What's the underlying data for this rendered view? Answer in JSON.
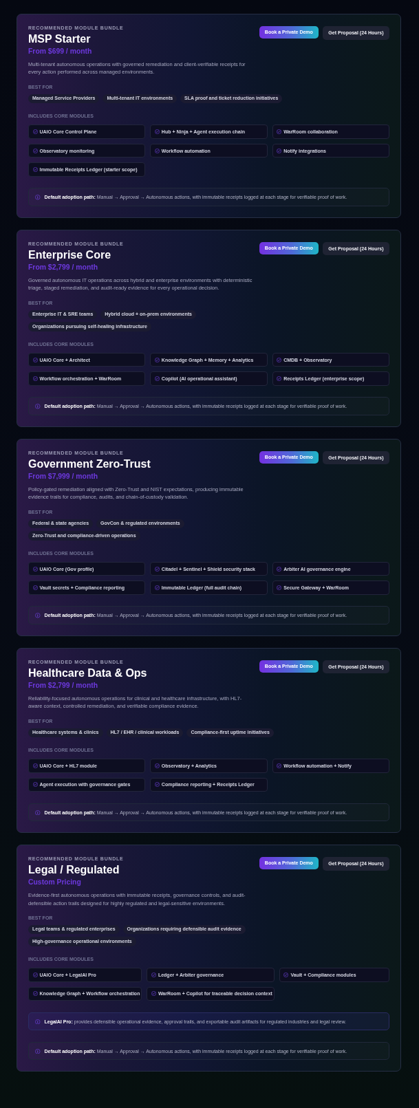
{
  "bundles": [
    {
      "eyebrow": "RECOMMENDED MODULE BUNDLE",
      "title": "MSP Starter",
      "price": "From $699 / month",
      "description": "Multi-tenant autonomous operations with governed remediation and client-verifiable receipts for every action performed across managed environments.",
      "best_for_label": "BEST FOR",
      "best_for": [
        "Managed Service Providers",
        "Multi-tenant IT environments",
        "SLA proof and ticket reduction initiatives"
      ],
      "modules_label": "INCLUDES CORE MODULES",
      "modules": [
        "UAIO Core Control Plane",
        "Hub + Ninja + Agent execution chain",
        "WarRoom collaboration",
        "Observatory monitoring",
        "Workflow automation",
        "Notify integrations",
        "Immutable Receipts Ledger (starter scope)"
      ],
      "notes": [
        {
          "kind": "adoption",
          "text": "**Default adoption path:** Manual → Approval → Autonomous actions, with immutable receipts logged at each stage for verifiable proof of work."
        }
      ],
      "buttons": [
        {
          "kind": "primary",
          "label": "Book a Private Demo"
        },
        {
          "kind": "secondary",
          "label": "Get Proposal (24 Hours)"
        }
      ]
    },
    {
      "eyebrow": "RECOMMENDED MODULE BUNDLE",
      "title": "Enterprise Core",
      "price": "From $2,799 / month",
      "description": "Governed autonomous IT operations across hybrid and enterprise environments with deterministic triage, staged remediation, and audit-ready evidence for every operational decision.",
      "best_for_label": "BEST FOR",
      "best_for": [
        "Enterprise IT & SRE teams",
        "Hybrid cloud + on-prem environments",
        "Organizations pursuing self-healing infrastructure"
      ],
      "modules_label": "INCLUDES CORE MODULES",
      "modules": [
        "UAIO Core + Architect",
        "Knowledge Graph + Memory + Analytics",
        "CMDB + Observatory",
        "Workflow orchestration + WarRoom",
        "Copilot (AI operational assistant)",
        "Receipts Ledger (enterprise scope)"
      ],
      "notes": [
        {
          "kind": "adoption",
          "text": "**Default adoption path:** Manual → Approval → Autonomous actions, with immutable receipts logged at each stage for verifiable proof of work."
        }
      ],
      "buttons": [
        {
          "kind": "primary",
          "label": "Book a Private Demo"
        },
        {
          "kind": "secondary",
          "label": "Get Proposal (24 Hours)"
        }
      ]
    },
    {
      "eyebrow": "RECOMMENDED MODULE BUNDLE",
      "title": "Government Zero-Trust",
      "price": "From $7,999 / month",
      "description": "Policy-gated remediation aligned with Zero-Trust and NIST expectations, producing immutable evidence trails for compliance, audits, and chain-of-custody validation.",
      "best_for_label": "BEST FOR",
      "best_for": [
        "Federal & state agencies",
        "GovCon & regulated environments",
        "Zero-Trust and compliance-driven operations"
      ],
      "modules_label": "INCLUDES CORE MODULES",
      "modules": [
        "UAIO Core (Gov profile)",
        "Citadel + Sentinel + Shield security stack",
        "Arbiter AI governance engine",
        "Vault secrets + Compliance reporting",
        "Immutable Ledger (full audit chain)",
        "Secure Gateway + WarRoom"
      ],
      "notes": [
        {
          "kind": "adoption",
          "text": "**Default adoption path:** Manual → Approval → Autonomous actions, with immutable receipts logged at each stage for verifiable proof of work."
        }
      ],
      "buttons": [
        {
          "kind": "primary",
          "label": "Book a Private Demo"
        },
        {
          "kind": "secondary",
          "label": "Get Proposal (24 Hours)"
        }
      ]
    },
    {
      "eyebrow": "RECOMMENDED MODULE BUNDLE",
      "title": "Healthcare Data & Ops",
      "price": "From $2,799 / month",
      "description": "Reliability-focused autonomous operations for clinical and healthcare infrastructure, with HL7-aware context, controlled remediation, and verifiable compliance evidence.",
      "best_for_label": "BEST FOR",
      "best_for": [
        "Healthcare systems & clinics",
        "HL7 / EHR / clinical workloads",
        "Compliance-first uptime initiatives"
      ],
      "modules_label": "INCLUDES CORE MODULES",
      "modules": [
        "UAIO Core + HL7 module",
        "Observatory + Analytics",
        "Workflow automation + Notify",
        "Agent execution with governance gates",
        "Compliance reporting + Receipts Ledger"
      ],
      "notes": [
        {
          "kind": "adoption",
          "text": "**Default adoption path:** Manual → Approval → Autonomous actions, with immutable receipts logged at each stage for verifiable proof of work."
        }
      ],
      "buttons": [
        {
          "kind": "primary",
          "label": "Book a Private Demo"
        },
        {
          "kind": "secondary",
          "label": "Get Proposal (24 Hours)"
        }
      ]
    },
    {
      "eyebrow": "RECOMMENDED MODULE BUNDLE",
      "title": "Legal / Regulated",
      "price": "Custom Pricing",
      "description": "Evidence-first autonomous operations with immutable receipts, governance controls, and audit-defensible action trails designed for highly regulated and legal-sensitive environments.",
      "best_for_label": "BEST FOR",
      "best_for": [
        "Legal teams & regulated enterprises",
        "Organizations requiring defensible audit evidence",
        "High-governance operational environments"
      ],
      "modules_label": "INCLUDES CORE MODULES",
      "modules": [
        "UAIO Core + LegalAI Pro",
        "Ledger + Arbiter governance",
        "Vault + Compliance modules",
        "Knowledge Graph + Workflow orchestration",
        "WarRoom + Copilot for traceable decision context"
      ],
      "notes": [
        {
          "kind": "highlight",
          "text": "**LegalAI Pro:** provides defensible operational evidence, approval trails, and exportable audit artifacts for regulated industries and legal review."
        },
        {
          "kind": "adoption",
          "text": "**Default adoption path:** Manual → Approval → Autonomous actions, with immutable receipts logged at each stage for verifiable proof of work."
        }
      ],
      "buttons": [
        {
          "kind": "primary",
          "label": "Book a Private Demo"
        },
        {
          "kind": "secondary",
          "label": "Get Proposal (24 Hours)"
        }
      ]
    }
  ]
}
